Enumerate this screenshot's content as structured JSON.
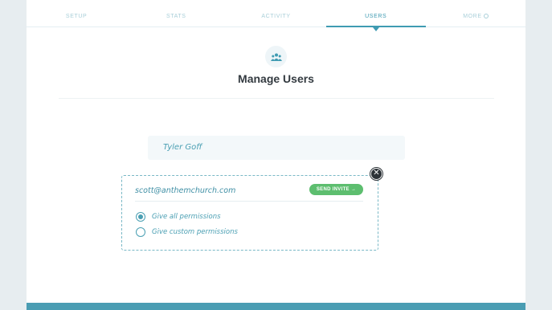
{
  "tabs": [
    {
      "label": "SETUP"
    },
    {
      "label": "STATS"
    },
    {
      "label": "ACTIVITY"
    },
    {
      "label": "USERS"
    },
    {
      "label": "MORE"
    }
  ],
  "active_tab": "USERS",
  "header": {
    "icon": "users-icon",
    "title": "Manage Users"
  },
  "existing_user": {
    "name": "Tyler Goff"
  },
  "invite": {
    "email_value": "scott@anthemchurch.com",
    "send_label": "SEND INVITE →",
    "permissions": [
      {
        "label": "Give all permissions",
        "checked": true
      },
      {
        "label": "Give custom permissions",
        "checked": false
      }
    ],
    "close_icon": "✕"
  },
  "colors": {
    "accent": "#4a9fb3",
    "send": "#5dbe6f",
    "dark": "#2c3237"
  }
}
